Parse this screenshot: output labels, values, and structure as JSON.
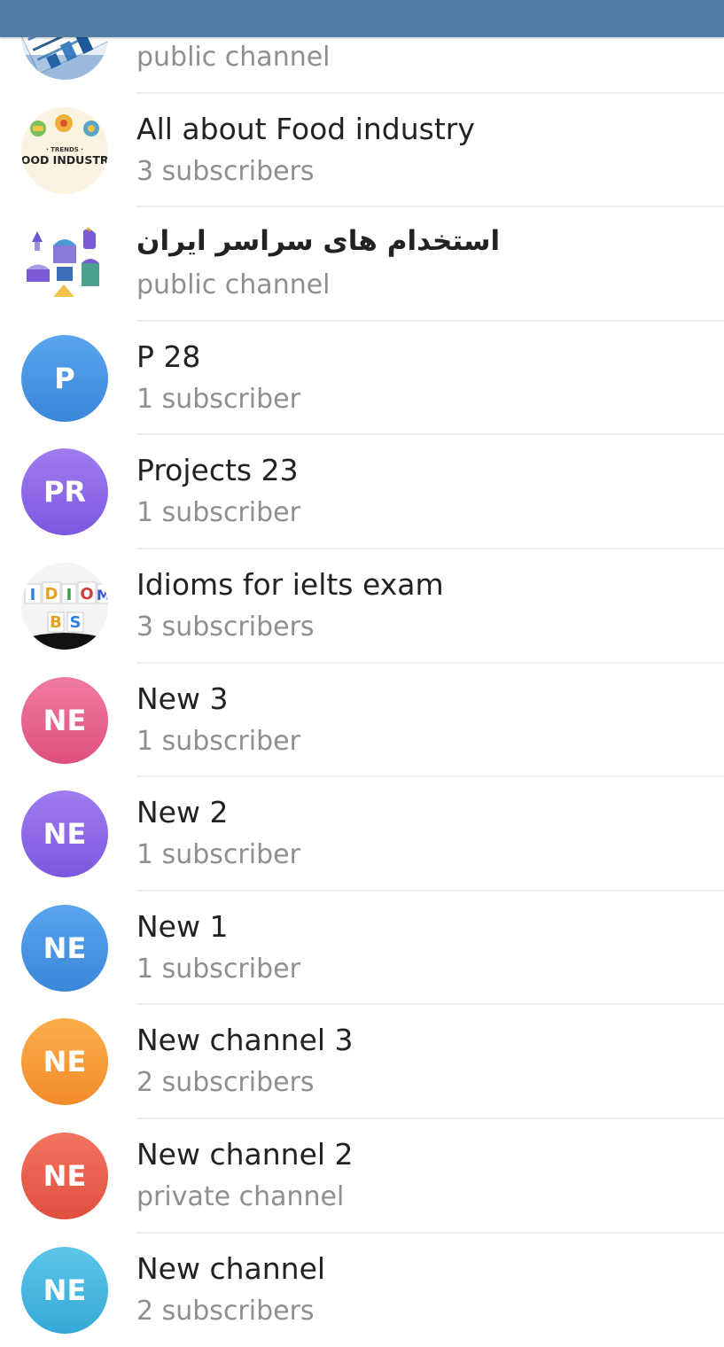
{
  "header": {
    "color": "#517da2"
  },
  "channels": [
    {
      "title": "",
      "subtitle": "public channel",
      "avatar": {
        "type": "image",
        "icon": "charts-photo-icon"
      }
    },
    {
      "title": "All about Food industry",
      "subtitle": "3 subscribers",
      "avatar": {
        "type": "image",
        "icon": "food-industry-logo-icon",
        "logo_text_1": "· TRENDS ·",
        "logo_text_2": "FOOD INDUSTRY"
      }
    },
    {
      "title": "استخدام های سراسر ایران",
      "subtitle": "public channel",
      "avatar": {
        "type": "image",
        "icon": "iran-landmarks-icon"
      }
    },
    {
      "title": "P 28",
      "subtitle": "1 subscriber",
      "avatar": {
        "type": "initials",
        "initials": "P",
        "color": "#3e8fe0"
      }
    },
    {
      "title": "Projects 23",
      "subtitle": "1 subscriber",
      "avatar": {
        "type": "initials",
        "initials": "PR",
        "color": "#8c64e8"
      }
    },
    {
      "title": "Idioms for ielts exam",
      "subtitle": "3 subscribers",
      "avatar": {
        "type": "image",
        "icon": "idioms-letters-icon"
      }
    },
    {
      "title": "New 3",
      "subtitle": "1 subscriber",
      "avatar": {
        "type": "initials",
        "initials": "NE",
        "color": "#e35d86"
      }
    },
    {
      "title": "New 2",
      "subtitle": "1 subscriber",
      "avatar": {
        "type": "initials",
        "initials": "NE",
        "color": "#8c64e8"
      }
    },
    {
      "title": "New 1",
      "subtitle": "1 subscriber",
      "avatar": {
        "type": "initials",
        "initials": "NE",
        "color": "#3e8fe0"
      }
    },
    {
      "title": "New channel 3",
      "subtitle": "2 subscribers",
      "avatar": {
        "type": "initials",
        "initials": "NE",
        "color": "#f59a33"
      }
    },
    {
      "title": "New channel 2",
      "subtitle": "private channel",
      "avatar": {
        "type": "initials",
        "initials": "NE",
        "color": "#e8584b"
      }
    },
    {
      "title": "New channel",
      "subtitle": "2 subscribers",
      "avatar": {
        "type": "initials",
        "initials": "NE",
        "color": "#3fb4dd"
      }
    }
  ]
}
